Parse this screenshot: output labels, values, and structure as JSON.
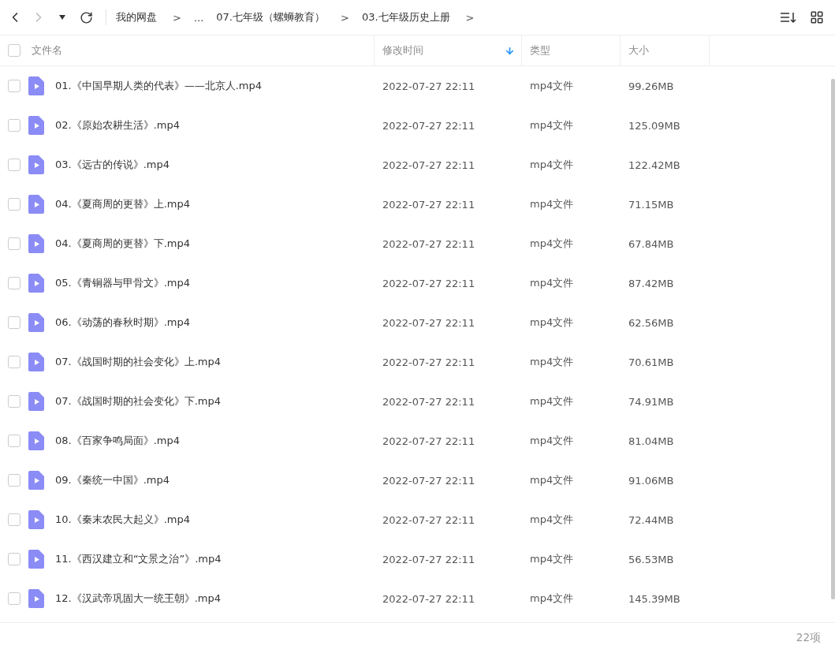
{
  "breadcrumb": [
    {
      "kind": "link",
      "label": "我的网盘"
    },
    {
      "kind": "sep",
      "label": ">"
    },
    {
      "kind": "link",
      "label": "..."
    },
    {
      "kind": "link",
      "label": "07.七年级（螺蛳教育）"
    },
    {
      "kind": "sep",
      "label": ">"
    },
    {
      "kind": "link",
      "label": "03.七年级历史上册"
    },
    {
      "kind": "sep",
      "label": ">"
    }
  ],
  "header": {
    "checked": false,
    "columns": [
      {
        "label": "文件名",
        "sorted": false
      },
      {
        "label": "修改时间",
        "sorted": true
      },
      {
        "label": "类型",
        "sorted": false
      },
      {
        "label": "大小",
        "sorted": false
      }
    ]
  },
  "rows": [
    {
      "checked": false,
      "name": "01.《中国早期人类的代表》——北京人.mp4",
      "time": "2022-07-27 22:11",
      "type": "mp4文件",
      "size": "99.26MB"
    },
    {
      "checked": false,
      "name": "02.《原始农耕生活》.mp4",
      "time": "2022-07-27 22:11",
      "type": "mp4文件",
      "size": "125.09MB"
    },
    {
      "checked": false,
      "name": "03.《远古的传说》.mp4",
      "time": "2022-07-27 22:11",
      "type": "mp4文件",
      "size": "122.42MB"
    },
    {
      "checked": false,
      "name": "04.《夏商周的更替》上.mp4",
      "time": "2022-07-27 22:11",
      "type": "mp4文件",
      "size": "71.15MB"
    },
    {
      "checked": false,
      "name": "04.《夏商周的更替》下.mp4",
      "time": "2022-07-27 22:11",
      "type": "mp4文件",
      "size": "67.84MB"
    },
    {
      "checked": false,
      "name": "05.《青铜器与甲骨文》.mp4",
      "time": "2022-07-27 22:11",
      "type": "mp4文件",
      "size": "87.42MB"
    },
    {
      "checked": false,
      "name": "06.《动荡的春秋时期》.mp4",
      "time": "2022-07-27 22:11",
      "type": "mp4文件",
      "size": "62.56MB"
    },
    {
      "checked": false,
      "name": "07.《战国时期的社会变化》上.mp4",
      "time": "2022-07-27 22:11",
      "type": "mp4文件",
      "size": "70.61MB"
    },
    {
      "checked": false,
      "name": "07.《战国时期的社会变化》下.mp4",
      "time": "2022-07-27 22:11",
      "type": "mp4文件",
      "size": "74.91MB"
    },
    {
      "checked": false,
      "name": "08.《百家争鸣局面》.mp4",
      "time": "2022-07-27 22:11",
      "type": "mp4文件",
      "size": "81.04MB"
    },
    {
      "checked": false,
      "name": "09.《秦统一中国》.mp4",
      "time": "2022-07-27 22:11",
      "type": "mp4文件",
      "size": "91.06MB"
    },
    {
      "checked": false,
      "name": "10.《秦末农民大起义》.mp4",
      "time": "2022-07-27 22:11",
      "type": "mp4文件",
      "size": "72.44MB"
    },
    {
      "checked": false,
      "name": "11.《西汉建立和“文景之治”》.mp4",
      "time": "2022-07-27 22:11",
      "type": "mp4文件",
      "size": "56.53MB"
    },
    {
      "checked": false,
      "name": "12.《汉武帝巩固大一统王朝》.mp4",
      "time": "2022-07-27 22:11",
      "type": "mp4文件",
      "size": "145.39MB"
    }
  ],
  "footer": {
    "count": "22项"
  }
}
